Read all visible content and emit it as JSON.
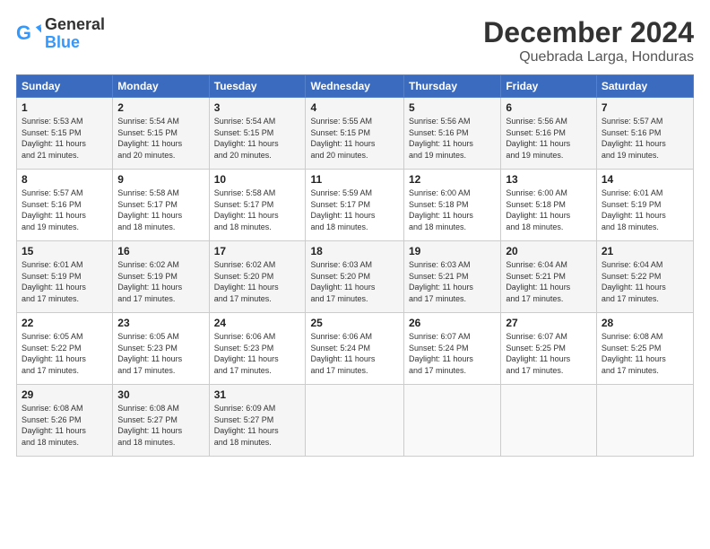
{
  "header": {
    "logo_general": "General",
    "logo_blue": "Blue",
    "month": "December 2024",
    "location": "Quebrada Larga, Honduras"
  },
  "days_of_week": [
    "Sunday",
    "Monday",
    "Tuesday",
    "Wednesday",
    "Thursday",
    "Friday",
    "Saturday"
  ],
  "weeks": [
    [
      {
        "day": "1",
        "info": "Sunrise: 5:53 AM\nSunset: 5:15 PM\nDaylight: 11 hours\nand 21 minutes."
      },
      {
        "day": "2",
        "info": "Sunrise: 5:54 AM\nSunset: 5:15 PM\nDaylight: 11 hours\nand 20 minutes."
      },
      {
        "day": "3",
        "info": "Sunrise: 5:54 AM\nSunset: 5:15 PM\nDaylight: 11 hours\nand 20 minutes."
      },
      {
        "day": "4",
        "info": "Sunrise: 5:55 AM\nSunset: 5:15 PM\nDaylight: 11 hours\nand 20 minutes."
      },
      {
        "day": "5",
        "info": "Sunrise: 5:56 AM\nSunset: 5:16 PM\nDaylight: 11 hours\nand 19 minutes."
      },
      {
        "day": "6",
        "info": "Sunrise: 5:56 AM\nSunset: 5:16 PM\nDaylight: 11 hours\nand 19 minutes."
      },
      {
        "day": "7",
        "info": "Sunrise: 5:57 AM\nSunset: 5:16 PM\nDaylight: 11 hours\nand 19 minutes."
      }
    ],
    [
      {
        "day": "8",
        "info": "Sunrise: 5:57 AM\nSunset: 5:16 PM\nDaylight: 11 hours\nand 19 minutes."
      },
      {
        "day": "9",
        "info": "Sunrise: 5:58 AM\nSunset: 5:17 PM\nDaylight: 11 hours\nand 18 minutes."
      },
      {
        "day": "10",
        "info": "Sunrise: 5:58 AM\nSunset: 5:17 PM\nDaylight: 11 hours\nand 18 minutes."
      },
      {
        "day": "11",
        "info": "Sunrise: 5:59 AM\nSunset: 5:17 PM\nDaylight: 11 hours\nand 18 minutes."
      },
      {
        "day": "12",
        "info": "Sunrise: 6:00 AM\nSunset: 5:18 PM\nDaylight: 11 hours\nand 18 minutes."
      },
      {
        "day": "13",
        "info": "Sunrise: 6:00 AM\nSunset: 5:18 PM\nDaylight: 11 hours\nand 18 minutes."
      },
      {
        "day": "14",
        "info": "Sunrise: 6:01 AM\nSunset: 5:19 PM\nDaylight: 11 hours\nand 18 minutes."
      }
    ],
    [
      {
        "day": "15",
        "info": "Sunrise: 6:01 AM\nSunset: 5:19 PM\nDaylight: 11 hours\nand 17 minutes."
      },
      {
        "day": "16",
        "info": "Sunrise: 6:02 AM\nSunset: 5:19 PM\nDaylight: 11 hours\nand 17 minutes."
      },
      {
        "day": "17",
        "info": "Sunrise: 6:02 AM\nSunset: 5:20 PM\nDaylight: 11 hours\nand 17 minutes."
      },
      {
        "day": "18",
        "info": "Sunrise: 6:03 AM\nSunset: 5:20 PM\nDaylight: 11 hours\nand 17 minutes."
      },
      {
        "day": "19",
        "info": "Sunrise: 6:03 AM\nSunset: 5:21 PM\nDaylight: 11 hours\nand 17 minutes."
      },
      {
        "day": "20",
        "info": "Sunrise: 6:04 AM\nSunset: 5:21 PM\nDaylight: 11 hours\nand 17 minutes."
      },
      {
        "day": "21",
        "info": "Sunrise: 6:04 AM\nSunset: 5:22 PM\nDaylight: 11 hours\nand 17 minutes."
      }
    ],
    [
      {
        "day": "22",
        "info": "Sunrise: 6:05 AM\nSunset: 5:22 PM\nDaylight: 11 hours\nand 17 minutes."
      },
      {
        "day": "23",
        "info": "Sunrise: 6:05 AM\nSunset: 5:23 PM\nDaylight: 11 hours\nand 17 minutes."
      },
      {
        "day": "24",
        "info": "Sunrise: 6:06 AM\nSunset: 5:23 PM\nDaylight: 11 hours\nand 17 minutes."
      },
      {
        "day": "25",
        "info": "Sunrise: 6:06 AM\nSunset: 5:24 PM\nDaylight: 11 hours\nand 17 minutes."
      },
      {
        "day": "26",
        "info": "Sunrise: 6:07 AM\nSunset: 5:24 PM\nDaylight: 11 hours\nand 17 minutes."
      },
      {
        "day": "27",
        "info": "Sunrise: 6:07 AM\nSunset: 5:25 PM\nDaylight: 11 hours\nand 17 minutes."
      },
      {
        "day": "28",
        "info": "Sunrise: 6:08 AM\nSunset: 5:25 PM\nDaylight: 11 hours\nand 17 minutes."
      }
    ],
    [
      {
        "day": "29",
        "info": "Sunrise: 6:08 AM\nSunset: 5:26 PM\nDaylight: 11 hours\nand 18 minutes."
      },
      {
        "day": "30",
        "info": "Sunrise: 6:08 AM\nSunset: 5:27 PM\nDaylight: 11 hours\nand 18 minutes."
      },
      {
        "day": "31",
        "info": "Sunrise: 6:09 AM\nSunset: 5:27 PM\nDaylight: 11 hours\nand 18 minutes."
      },
      null,
      null,
      null,
      null
    ]
  ]
}
